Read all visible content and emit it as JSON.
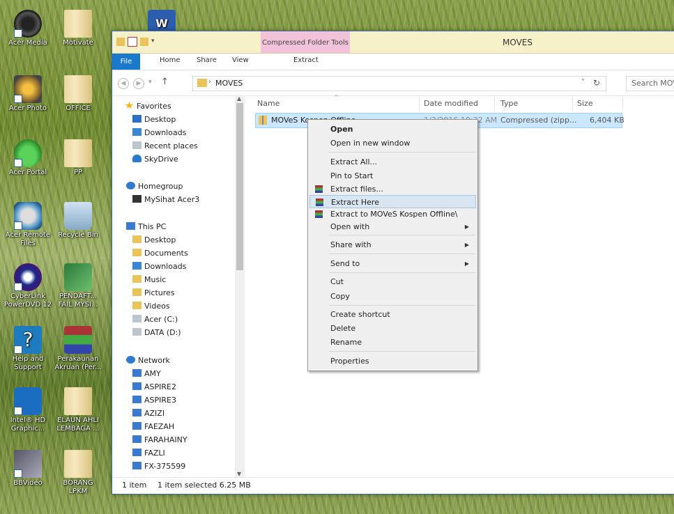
{
  "desktop": {
    "icons": [
      {
        "label": "Acer Media"
      },
      {
        "label": "Motivate"
      },
      {
        "label": "Acer Photo"
      },
      {
        "label": "OFFICE"
      },
      {
        "label": "Acer Portal"
      },
      {
        "label": "PP"
      },
      {
        "label": "Acer Remote Files"
      },
      {
        "label": "Recycle Bin"
      },
      {
        "label": "CyberLink PowerDVD 12"
      },
      {
        "label": "PENDAFT... FAIL MYSI..."
      },
      {
        "label": "Help and Support"
      },
      {
        "label": "Perakaunan Akruan (Per..."
      },
      {
        "label": "Intel® HD Graphic..."
      },
      {
        "label": "ELAUN AHLI LEMBAGA ..."
      },
      {
        "label": "BBVideo"
      },
      {
        "label": "BORANG LPKM"
      }
    ]
  },
  "window": {
    "title": "MOVES",
    "contextual_tab_group": "Compressed Folder Tools",
    "tabs": [
      "File",
      "Home",
      "Share",
      "View",
      "Extract"
    ],
    "address": {
      "path": "MOVES"
    },
    "search": {
      "placeholder": "Search MOVES"
    }
  },
  "navpane": {
    "favorites": {
      "header": "Favorites",
      "items": [
        "Desktop",
        "Downloads",
        "Recent places",
        "SkyDrive"
      ]
    },
    "homegroup": {
      "header": "Homegroup",
      "items": [
        "MySihat Acer3"
      ]
    },
    "thispc": {
      "header": "This PC",
      "items": [
        "Desktop",
        "Documents",
        "Downloads",
        "Music",
        "Pictures",
        "Videos",
        "Acer (C:)",
        "DATA (D:)"
      ]
    },
    "network": {
      "header": "Network",
      "items": [
        "AMY",
        "ASPIRE2",
        "ASPIRE3",
        "AZIZI",
        "FAEZAH",
        "FARAHAINY",
        "FAZLI",
        "FX-375599"
      ]
    }
  },
  "files": {
    "columns": [
      "Name",
      "Date modified",
      "Type",
      "Size"
    ],
    "rows": [
      {
        "name": "MOVeS Kospen Offline",
        "date": "1/3/2016 10:32 AM",
        "type": "Compressed (zipp...",
        "size": "6,404 KB"
      }
    ]
  },
  "status": {
    "count": "1 item",
    "selection": "1 item selected  6.25 MB"
  },
  "context_menu": {
    "items": [
      {
        "label": "Open"
      },
      {
        "label": "Open in new window"
      },
      {
        "label": "Extract All..."
      },
      {
        "label": "Pin to Start"
      },
      {
        "label": "Extract files..."
      },
      {
        "label": "Extract Here"
      },
      {
        "label": "Extract to MOVeS Kospen Offline\\"
      },
      {
        "label": "Open with"
      },
      {
        "label": "Share with"
      },
      {
        "label": "Send to"
      },
      {
        "label": "Cut"
      },
      {
        "label": "Copy"
      },
      {
        "label": "Create shortcut"
      },
      {
        "label": "Delete"
      },
      {
        "label": "Rename"
      },
      {
        "label": "Properties"
      }
    ],
    "highlighted": "Extract Here"
  }
}
